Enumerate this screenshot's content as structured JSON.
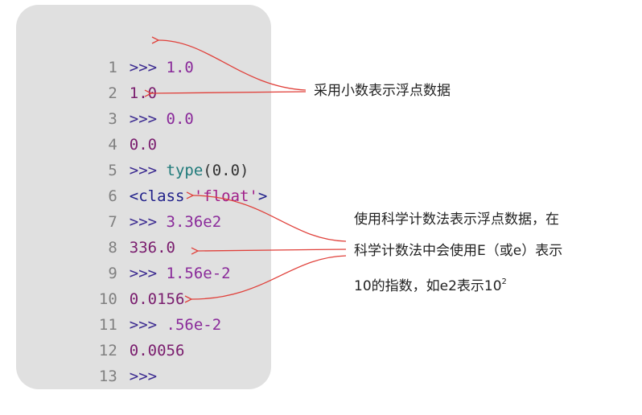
{
  "code_lines": [
    {
      "n": "1",
      "prompt": ">>> ",
      "text": "1.0",
      "kind": "num"
    },
    {
      "n": "2",
      "prompt": "",
      "text": "1.0",
      "kind": "out"
    },
    {
      "n": "3",
      "prompt": ">>> ",
      "text": "0.0",
      "kind": "num"
    },
    {
      "n": "4",
      "prompt": "",
      "text": "0.0",
      "kind": "out"
    },
    {
      "n": "5",
      "prompt": ">>> ",
      "fn": "type",
      "arg": "(0.0)",
      "kind": "call"
    },
    {
      "n": "6",
      "prompt": "",
      "cls": "<class ",
      "str": "'float'",
      "end": ">",
      "kind": "class"
    },
    {
      "n": "7",
      "prompt": ">>> ",
      "text": "3.36e2",
      "kind": "num"
    },
    {
      "n": "8",
      "prompt": "",
      "text": "336.0",
      "kind": "out"
    },
    {
      "n": "9",
      "prompt": ">>> ",
      "text": "1.56e-2",
      "kind": "num"
    },
    {
      "n": "10",
      "prompt": "",
      "text": "0.0156",
      "kind": "out"
    },
    {
      "n": "11",
      "prompt": ">>> ",
      "text": ".56e-2",
      "kind": "num"
    },
    {
      "n": "12",
      "prompt": "",
      "text": "0.0056",
      "kind": "out"
    },
    {
      "n": "13",
      "prompt": ">>>",
      "text": "",
      "kind": "num"
    }
  ],
  "annotations": {
    "decimal_note": "采用小数表示浮点数据",
    "sci_note_line1": "使用科学计数法表示浮点数据，在",
    "sci_note_line2": "科学计数法中会使用E（或e）表示",
    "sci_note_line3_pre": "10的指数，如e2表示10",
    "sci_note_line3_sup": "2"
  },
  "colors": {
    "arrow": "#e0403a",
    "panel": "#e0e0e0"
  }
}
